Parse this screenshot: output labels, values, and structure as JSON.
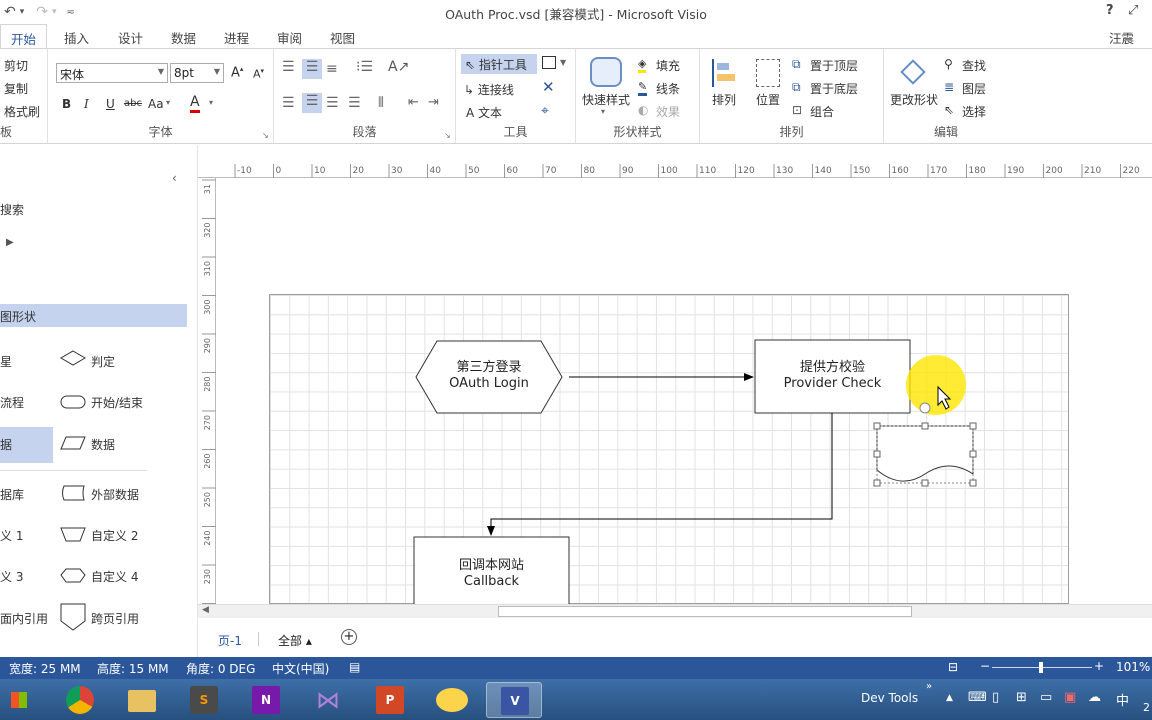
{
  "window": {
    "title": "OAuth Proc.vsd  [兼容模式] - Microsoft Visio",
    "help": "?",
    "user": "汪震"
  },
  "menu_tabs": [
    "开始",
    "插入",
    "设计",
    "数据",
    "进程",
    "审阅",
    "视图"
  ],
  "ribbon": {
    "clipboard": {
      "cut": "剪切",
      "copy": "复制",
      "format_painter": "格式刷",
      "label": "板"
    },
    "font": {
      "name": "宋体",
      "size": "8pt",
      "label": "字体",
      "bold": "B",
      "italic": "I",
      "underline": "U",
      "strike": "abc",
      "case": "Aa",
      "color": "A"
    },
    "paragraph": {
      "label": "段落"
    },
    "tools": {
      "pointer": "指针工具",
      "connector": "连接线",
      "text": "文本",
      "label": "工具"
    },
    "shape_styles": {
      "quick_styles": "快速样式",
      "fill": "填充",
      "line": "线条",
      "effects": "效果",
      "label": "形状样式"
    },
    "arrange": {
      "align": "排列",
      "position": "位置",
      "bring_front": "置于顶层",
      "send_back": "置于底层",
      "group": "组合",
      "label": "排列"
    },
    "editing": {
      "change_shape": "更改形状",
      "find": "查找",
      "layers": "图层",
      "select": "选择",
      "label": "编辑"
    }
  },
  "shapes_panel": {
    "search": "搜索",
    "category": "图形状",
    "items": [
      {
        "left": "星",
        "right": "判定"
      },
      {
        "left": "流程",
        "right": "开始/结束"
      },
      {
        "left": "据",
        "right": "数据"
      },
      {
        "left": "据库",
        "right": "外部数据"
      },
      {
        "left": "义 1",
        "right": "自定义 2"
      },
      {
        "left": "义 3",
        "right": "自定义 4"
      },
      {
        "left": "面内引用",
        "right": "跨页引用"
      }
    ]
  },
  "ruler": {
    "h": [
      "-10",
      "0",
      "10",
      "20",
      "30",
      "40",
      "50",
      "60",
      "70",
      "80",
      "90",
      "100",
      "110",
      "120",
      "130",
      "140",
      "150",
      "160",
      "170",
      "180",
      "190",
      "200",
      "210",
      "220",
      "23"
    ],
    "v": [
      "31",
      "320",
      "310",
      "300",
      "290",
      "280",
      "270",
      "260",
      "250",
      "240",
      "230",
      "220"
    ]
  },
  "diagram": {
    "hex": {
      "line1": "第三方登录",
      "line2": "OAuth Login"
    },
    "check": {
      "line1": "提供方校验",
      "line2": "Provider Check"
    },
    "callback": {
      "line1": "回调本网站",
      "line2": "Callback"
    }
  },
  "page_tabs": {
    "page": "页-1",
    "all": "全部 ▴",
    "add": "+"
  },
  "status": {
    "width": "宽度: 25 MM",
    "height": "高度: 15 MM",
    "angle": "角度: 0 DEG",
    "lang": "中文(中国)",
    "zoom": "101%"
  },
  "taskbar": {
    "dev_tools": "Dev Tools",
    "ime": "中",
    "clock": "2"
  },
  "colors": {
    "accent": "#2b579a",
    "selection": "#c5d3ef",
    "highlight": "#ffe600"
  }
}
